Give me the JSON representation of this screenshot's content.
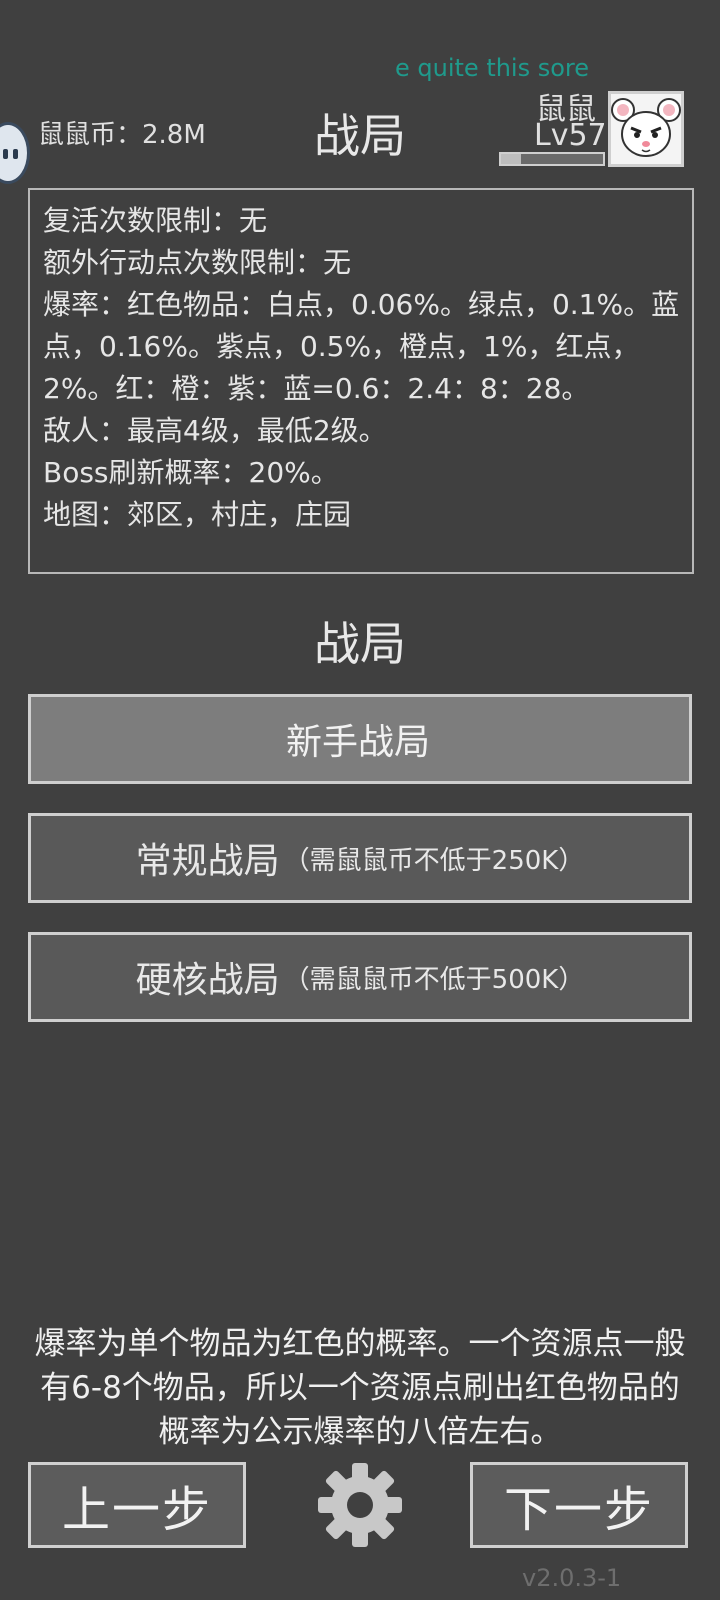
{
  "overlay": {
    "text": "e quite this sore"
  },
  "header": {
    "coins": "鼠鼠币：2.8M",
    "title": "战局",
    "player_name": "鼠鼠",
    "player_level": "Lv57",
    "xp_progress": 0.2
  },
  "info": {
    "lines": [
      "复活次数限制：无",
      "额外行动点次数限制：无",
      "爆率：红色物品：白点，0.06%。绿点，0.1%。蓝点，0.16%。紫点，0.5%，橙点，1%，红点，2%。红：橙：紫：蓝=0.6：2.4：8：28。",
      "敌人：最高4级，最低2级。",
      "Boss刷新概率：20%。",
      "地图：郊区，村庄，庄园"
    ]
  },
  "section_title": "战局",
  "modes": [
    {
      "label": "新手战局",
      "requirement": "",
      "selected": true
    },
    {
      "label": "常规战局",
      "requirement": "（需鼠鼠币不低于250K）",
      "selected": false
    },
    {
      "label": "硬核战局",
      "requirement": "（需鼠鼠币不低于500K）",
      "selected": false
    }
  ],
  "footer": {
    "note": "爆率为单个物品为红色的概率。一个资源点一般有6-8个物品，所以一个资源点刷出红色物品的概率为公示爆率的八倍左右。",
    "prev_label": "上一步",
    "next_label": "下一步",
    "settings_icon": "gear-icon",
    "version": "v2.0.3-1"
  },
  "colors": {
    "background": "#404040",
    "overlay_text": "#1f9a8c",
    "button_border": "#cfcfcf",
    "selected_button": "#7d7d7d"
  }
}
